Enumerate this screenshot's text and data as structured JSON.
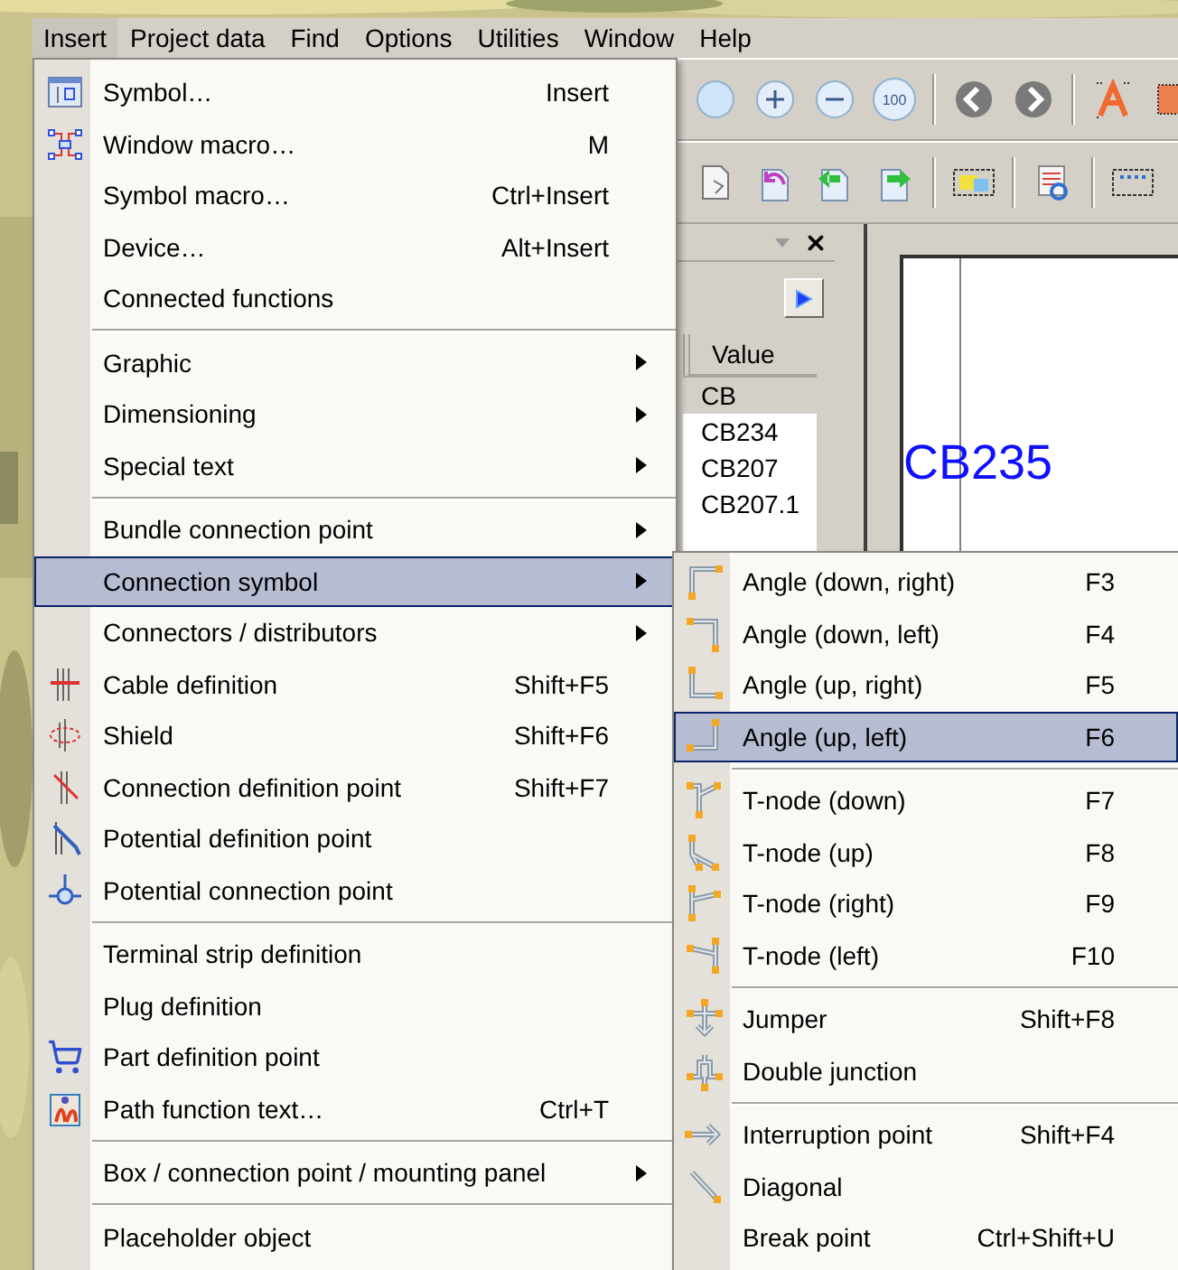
{
  "menu_bar": [
    {
      "label": "Insert",
      "selected": true
    },
    {
      "label": "Project data",
      "selected": false
    },
    {
      "label": "Find",
      "selected": false
    },
    {
      "label": "Options",
      "selected": false
    },
    {
      "label": "Utilities",
      "selected": false
    },
    {
      "label": "Window",
      "selected": false
    },
    {
      "label": "Help",
      "selected": false
    }
  ],
  "toolbar": {
    "zoom_label": "100"
  },
  "panel": {
    "column": "Value",
    "rows": [
      {
        "value": "CB",
        "selected": true
      },
      {
        "value": "CB234",
        "selected": false
      },
      {
        "value": "CB207",
        "selected": false
      },
      {
        "value": "CB207.1",
        "selected": false
      }
    ]
  },
  "canvas": {
    "text": "CB235"
  },
  "insert_menu": {
    "groups": [
      [
        {
          "label": "Symbol…",
          "shortcut": "Insert",
          "submenu": false,
          "selected": false
        },
        {
          "label": "Window macro…",
          "shortcut": "M",
          "submenu": false,
          "selected": false
        },
        {
          "label": "Symbol macro…",
          "shortcut": "Ctrl+Insert",
          "submenu": false,
          "selected": false
        },
        {
          "label": "Device…",
          "shortcut": "Alt+Insert",
          "submenu": false,
          "selected": false
        },
        {
          "label": "Connected functions",
          "submenu": false,
          "selected": false
        }
      ],
      [
        {
          "label": "Graphic",
          "submenu": true,
          "selected": false
        },
        {
          "label": "Dimensioning",
          "submenu": true,
          "selected": false
        },
        {
          "label": "Special text",
          "submenu": true,
          "selected": false
        }
      ],
      [
        {
          "label": "Bundle connection point",
          "submenu": true,
          "selected": false
        },
        {
          "label": "Connection symbol",
          "submenu": true,
          "selected": true
        },
        {
          "label": "Connectors / distributors",
          "submenu": true,
          "selected": false
        },
        {
          "label": "Cable definition",
          "shortcut": "Shift+F5",
          "submenu": false,
          "selected": false
        },
        {
          "label": "Shield",
          "shortcut": "Shift+F6",
          "submenu": false,
          "selected": false
        },
        {
          "label": "Connection definition point",
          "shortcut": "Shift+F7",
          "submenu": false,
          "selected": false
        },
        {
          "label": "Potential definition point",
          "submenu": false,
          "selected": false
        },
        {
          "label": "Potential connection point",
          "submenu": false,
          "selected": false
        }
      ],
      [
        {
          "label": "Terminal strip definition",
          "submenu": false,
          "selected": false
        },
        {
          "label": "Plug definition",
          "submenu": false,
          "selected": false
        },
        {
          "label": "Part definition point",
          "submenu": false,
          "selected": false
        },
        {
          "label": "Path function text…",
          "shortcut": "Ctrl+T",
          "submenu": false,
          "selected": false
        }
      ],
      [
        {
          "label": "Box / connection point / mounting panel",
          "submenu": true,
          "selected": false
        }
      ],
      [
        {
          "label": "Placeholder object",
          "submenu": false,
          "selected": false
        }
      ]
    ]
  },
  "connection_symbol_menu": {
    "groups": [
      [
        {
          "label": "Angle (down, right)",
          "shortcut": "F3",
          "selected": false
        },
        {
          "label": "Angle (down, left)",
          "shortcut": "F4",
          "selected": false
        },
        {
          "label": "Angle (up, right)",
          "shortcut": "F5",
          "selected": false
        },
        {
          "label": "Angle (up, left)",
          "shortcut": "F6",
          "selected": true
        }
      ],
      [
        {
          "label": "T-node (down)",
          "shortcut": "F7",
          "selected": false
        },
        {
          "label": "T-node (up)",
          "shortcut": "F8",
          "selected": false
        },
        {
          "label": "T-node (right)",
          "shortcut": "F9",
          "selected": false
        },
        {
          "label": "T-node (left)",
          "shortcut": "F10",
          "selected": false
        }
      ],
      [
        {
          "label": "Jumper",
          "shortcut": "Shift+F8",
          "selected": false
        },
        {
          "label": "Double junction",
          "selected": false
        }
      ],
      [
        {
          "label": "Interruption point",
          "shortcut": "Shift+F4",
          "selected": false
        },
        {
          "label": "Diagonal",
          "selected": false
        },
        {
          "label": "Break point",
          "shortcut": "Ctrl+Shift+U",
          "selected": false
        }
      ]
    ]
  }
}
